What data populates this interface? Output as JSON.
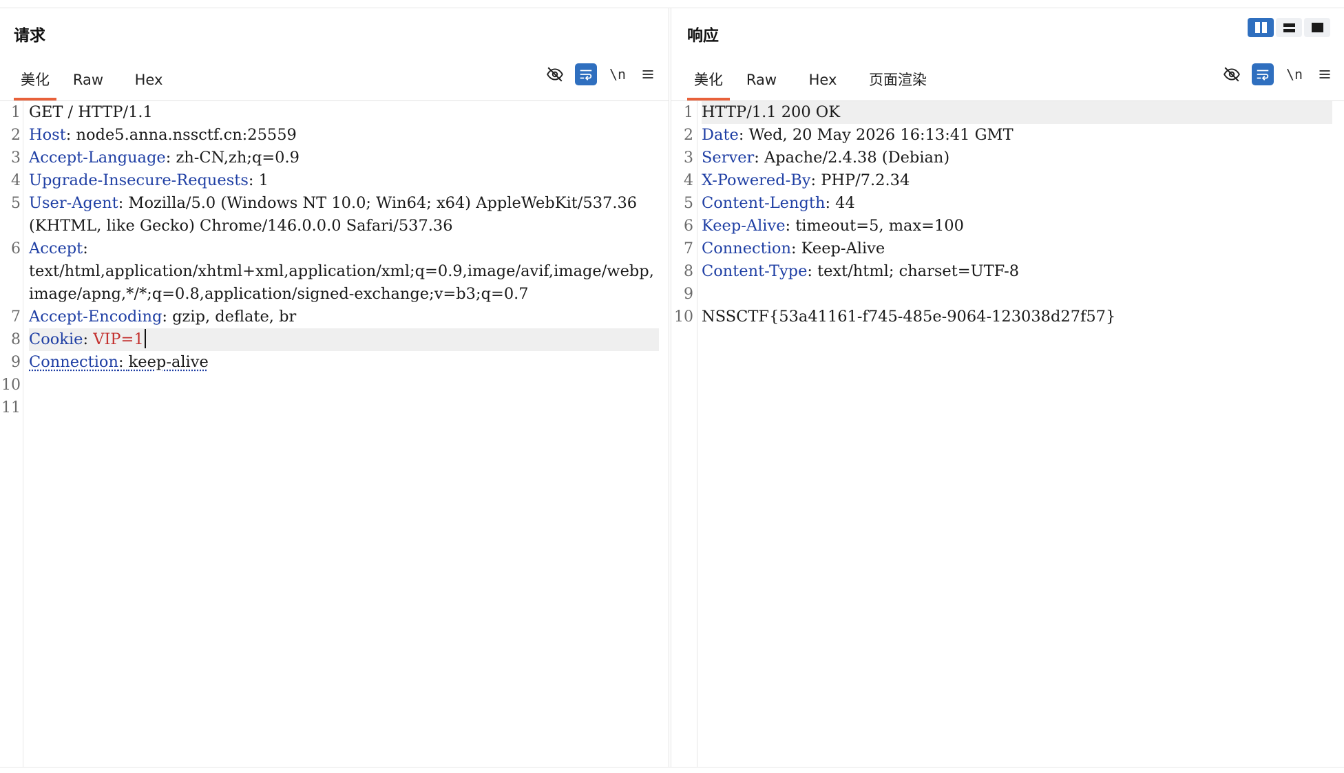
{
  "request": {
    "title": "请求",
    "tabs": [
      "美化",
      "Raw",
      "Hex"
    ],
    "active_tab": "美化",
    "toolbar": {
      "newline_label": "\\n"
    },
    "lines": [
      {
        "n": "1",
        "key": "",
        "sep": "",
        "value": "GET / HTTP/1.1"
      },
      {
        "n": "2",
        "key": "Host",
        "sep": ": ",
        "value": "node5.anna.nssctf.cn:25559"
      },
      {
        "n": "3",
        "key": "Accept-Language",
        "sep": ": ",
        "value": "zh-CN,zh;q=0.9"
      },
      {
        "n": "4",
        "key": "Upgrade-Insecure-Requests",
        "sep": ": ",
        "value": "1"
      },
      {
        "n": "5",
        "key": "User-Agent",
        "sep": ": ",
        "value": "Mozilla/5.0 (Windows NT 10.0; Win64; x64) AppleWebKit/537.36 (KHTML, like Gecko) Chrome/146.0.0.0 Safari/537.36"
      },
      {
        "n": "6",
        "key": "Accept",
        "sep": ":",
        "value": "text/html,application/xhtml+xml,application/xml;q=0.9,image/avif,image/webp,image/apng,*/*;q=0.8,application/signed-exchange;v=b3;q=0.7"
      },
      {
        "n": "7",
        "key": "Accept-Encoding",
        "sep": ": ",
        "value": "gzip, deflate, br"
      },
      {
        "n": "8",
        "key": "Cookie",
        "sep": ": ",
        "value": "VIP=1"
      },
      {
        "n": "9",
        "key": "Connection",
        "sep": ": ",
        "value": "keep-alive"
      },
      {
        "n": "10",
        "key": "",
        "sep": "",
        "value": ""
      },
      {
        "n": "11",
        "key": "",
        "sep": "",
        "value": ""
      }
    ]
  },
  "response": {
    "title": "响应",
    "tabs": [
      "美化",
      "Raw",
      "Hex",
      "页面渲染"
    ],
    "active_tab": "美化",
    "toolbar": {
      "newline_label": "\\n"
    },
    "lines": [
      {
        "n": "1",
        "key": "",
        "sep": "",
        "value": "HTTP/1.1 200 OK"
      },
      {
        "n": "2",
        "key": "Date",
        "sep": ": ",
        "value": "Wed, 20 May 2026 16:13:41 GMT"
      },
      {
        "n": "3",
        "key": "Server",
        "sep": ": ",
        "value": "Apache/2.4.38 (Debian)"
      },
      {
        "n": "4",
        "key": "X-Powered-By",
        "sep": ": ",
        "value": "PHP/7.2.34"
      },
      {
        "n": "5",
        "key": "Content-Length",
        "sep": ": ",
        "value": "44"
      },
      {
        "n": "6",
        "key": "Keep-Alive",
        "sep": ": ",
        "value": "timeout=5, max=100"
      },
      {
        "n": "7",
        "key": "Connection",
        "sep": ": ",
        "value": "Keep-Alive"
      },
      {
        "n": "8",
        "key": "Content-Type",
        "sep": ": ",
        "value": "text/html; charset=UTF-8"
      },
      {
        "n": "9",
        "key": "",
        "sep": "",
        "value": ""
      },
      {
        "n": "10",
        "key": "",
        "sep": "",
        "value": "NSSCTF{53a41161-f745-485e-9064-123038d27f57}"
      }
    ]
  },
  "colors": {
    "accent": "#e8613a",
    "toggle_on": "#2f6fbf",
    "header_key": "#1f3fa4",
    "cookie_value": "#c3312f"
  },
  "icons": [
    "eye-off-icon",
    "wrap-icon",
    "newline-icon",
    "menu-icon",
    "layout-split-icon",
    "layout-stack-icon",
    "layout-single-icon"
  ]
}
